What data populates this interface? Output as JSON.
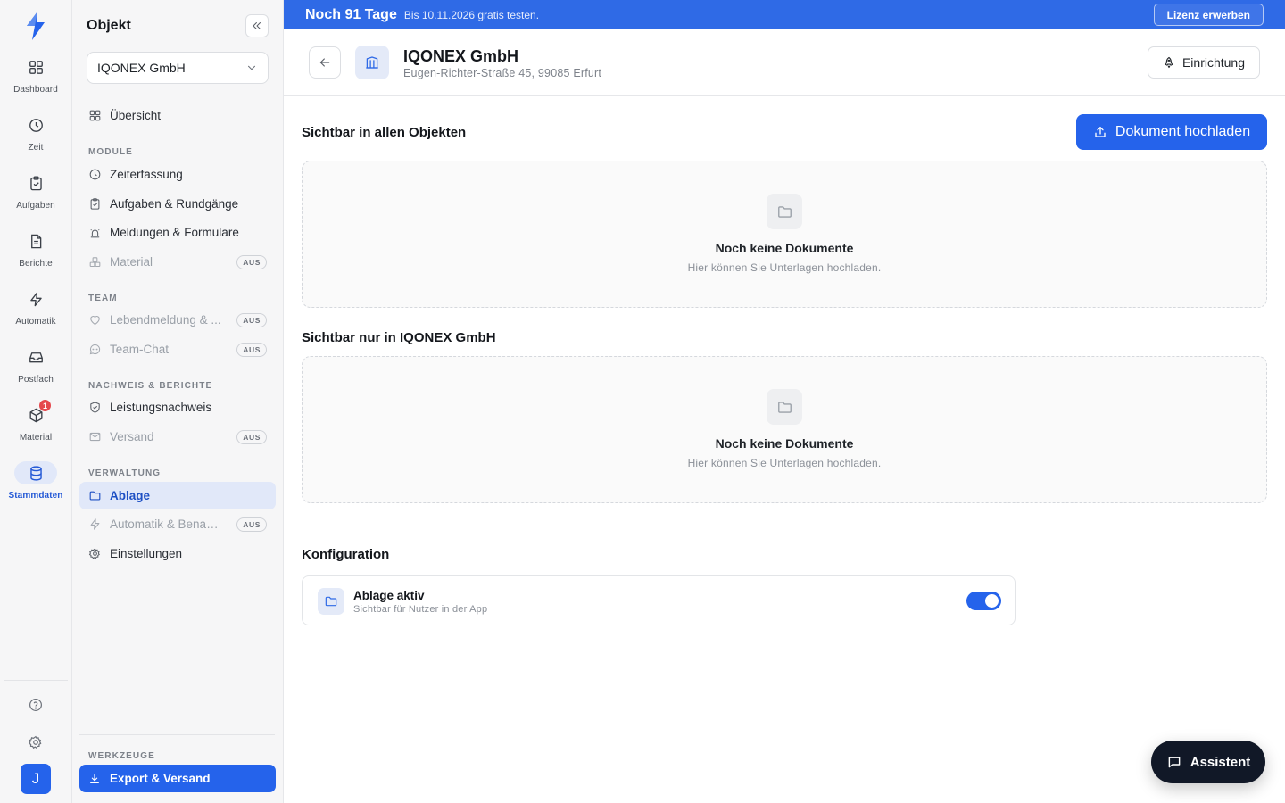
{
  "colors": {
    "accent": "#2563eb",
    "banner": "#2f6ae6",
    "badge": "#e5484d",
    "active_bg": "#e1e8f9"
  },
  "rail": {
    "items": [
      {
        "label": "Dashboard",
        "icon": "dashboard-grid-icon"
      },
      {
        "label": "Zeit",
        "icon": "clock-icon"
      },
      {
        "label": "Aufgaben",
        "icon": "clipboard-check-icon"
      },
      {
        "label": "Berichte",
        "icon": "file-text-icon"
      },
      {
        "label": "Automatik",
        "icon": "lightning-icon"
      },
      {
        "label": "Postfach",
        "icon": "inbox-icon"
      },
      {
        "label": "Material",
        "icon": "package-icon",
        "badge": "1"
      },
      {
        "label": "Stammdaten",
        "icon": "database-icon",
        "active": true
      }
    ],
    "avatar_initial": "J"
  },
  "sidebar": {
    "title": "Objekt",
    "object_select": "IQONEX GmbH",
    "overview": "Übersicht",
    "sections": {
      "module": "MODULE",
      "team": "TEAM",
      "nachweis": "NACHWEIS & BERICHTE",
      "verwaltung": "VERWALTUNG",
      "werkzeuge": "WERKZEUGE"
    },
    "items": {
      "zeiterfassung": "Zeiterfassung",
      "aufgaben": "Aufgaben & Rundgänge",
      "meldungen": "Meldungen & Formulare",
      "material": "Material",
      "lebendmeldung": "Lebendmeldung & ...",
      "teamchat": "Team-Chat",
      "leistungsnachweis": "Leistungsnachweis",
      "versand": "Versand",
      "ablage": "Ablage",
      "automatik": "Automatik & Benachrichtigungen",
      "einstellungen": "Einstellungen"
    },
    "aus_badge": "AUS",
    "export": "Export & Versand"
  },
  "banner": {
    "title": "Noch 91 Tage",
    "subtitle": "Bis 10.11.2026 gratis testen.",
    "button": "Lizenz erwerben"
  },
  "header": {
    "title": "IQONEX GmbH",
    "address": "Eugen-Richter-Straße 45, 99085 Erfurt",
    "setup_button": "Einrichtung"
  },
  "main": {
    "section_all": "Sichtbar in allen Objekten",
    "upload_button": "Dokument hochladen",
    "section_object": "Sichtbar nur in IQONEX GmbH",
    "empty_title": "Noch keine Dokumente",
    "empty_subtitle": "Hier können Sie Unterlagen hochladen.",
    "config_title": "Konfiguration",
    "config": {
      "title": "Ablage aktiv",
      "subtitle": "Sichtbar für Nutzer in der App",
      "enabled": true
    }
  },
  "assistant": "Assistent"
}
